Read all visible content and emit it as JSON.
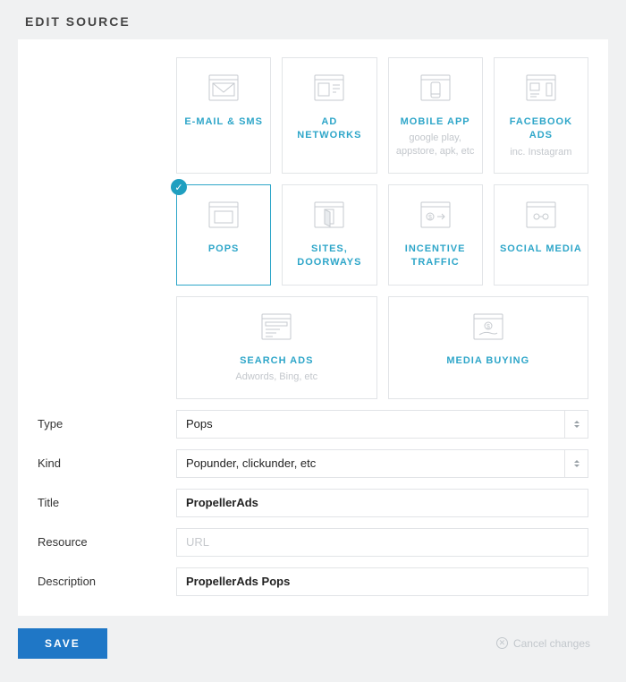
{
  "title": "EDIT SOURCE",
  "tiles": [
    {
      "name": "E-MAIL & SMS",
      "sub": ""
    },
    {
      "name": "AD NETWORKS",
      "sub": ""
    },
    {
      "name": "MOBILE APP",
      "sub": "google play, appstore, apk, etc"
    },
    {
      "name": "FACEBOOK ADS",
      "sub": "inc. Instagram"
    },
    {
      "name": "POPS",
      "sub": ""
    },
    {
      "name": "SITES, DOORWAYS",
      "sub": ""
    },
    {
      "name": "INCENTIVE TRAFFIC",
      "sub": ""
    },
    {
      "name": "SOCIAL MEDIA",
      "sub": ""
    },
    {
      "name": "SEARCH ADS",
      "sub": "Adwords, Bing, etc"
    },
    {
      "name": "MEDIA BUYING",
      "sub": ""
    }
  ],
  "selected_tile_index": 4,
  "form": {
    "type": {
      "label": "Type",
      "value": "Pops"
    },
    "kind": {
      "label": "Kind",
      "value": "Popunder, clickunder, etc"
    },
    "title_f": {
      "label": "Title",
      "value": "PropellerAds"
    },
    "resource": {
      "label": "Resource",
      "value": "",
      "placeholder": "URL"
    },
    "description": {
      "label": "Description",
      "value": "PropellerAds Pops"
    }
  },
  "footer": {
    "save": "SAVE",
    "cancel": "Cancel changes"
  },
  "colors": {
    "accent": "#2ea6c9",
    "primaryBtn": "#1f77c6"
  }
}
